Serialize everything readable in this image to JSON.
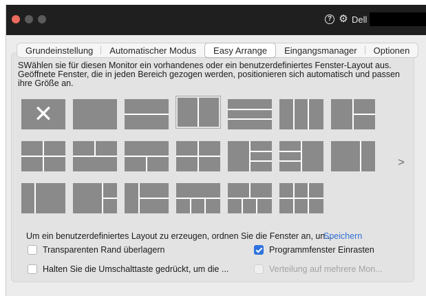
{
  "titlebar": {
    "app_name": "Dell",
    "help_glyph": "?",
    "gear_glyph": "⚙"
  },
  "tabs": [
    {
      "label": "Grundeinstellung",
      "active": false
    },
    {
      "label": "Automatischer Modus",
      "active": false
    },
    {
      "label": "Easy Arrange",
      "active": true
    },
    {
      "label": "Eingangsmanager",
      "active": false
    },
    {
      "label": "Optionen",
      "active": false
    }
  ],
  "description": "SWählen sie für diesen Monitor ein vorhandenes oder ein benutzerdefiniertes Fenster-Layout aus. Geöffnete Fenster, die in jeden Bereich gezogen werden, positionieren sich automatisch und passen ihre Größe an.",
  "layouts": {
    "clear_glyph": "✕",
    "next_glyph": ">",
    "selected_index": 3,
    "count": 20
  },
  "custom": {
    "text": "Um ein benutzerdefiniertes Layout zu erzeugen, ordnen Sie die Fenster an, un...",
    "save_label": "Speichern"
  },
  "options": {
    "transparent_border": {
      "label": "Transparenten Rand überlagern",
      "checked": false
    },
    "snap_windows": {
      "label": "Programmfenster Einrasten",
      "checked": true
    },
    "hold_shift": {
      "label": "Halten Sie die Umschalttaste gedrückt, um die ...",
      "checked": false
    },
    "multi_monitor": {
      "label": "Verteilung auf mehrere Mon...",
      "checked": false,
      "disabled": true
    }
  },
  "colors": {
    "titlebar": "#1f1f1f",
    "tile": "#8a8a8a",
    "accent": "#2f72de",
    "link": "#2f6fd6",
    "close_button": "#ed6a5e"
  }
}
